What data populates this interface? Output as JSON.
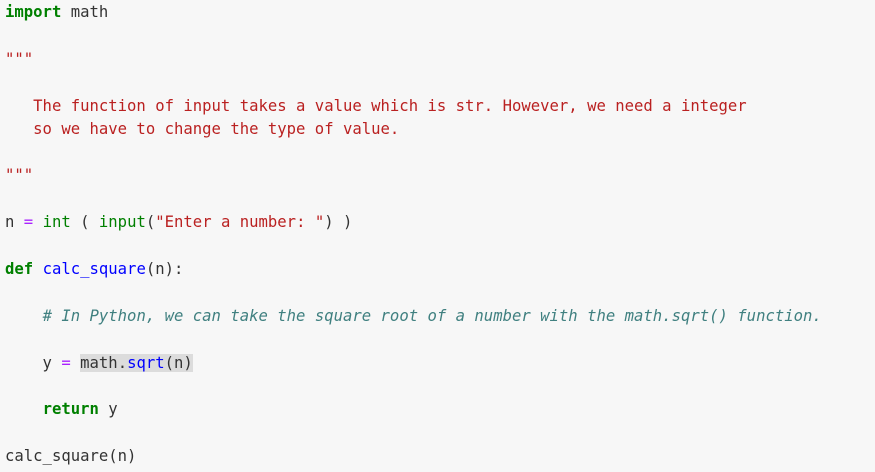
{
  "code": {
    "import_kw": "import",
    "import_mod": " math",
    "docstring_open": "\"\"\"",
    "doc_line1": "   The function of input takes a value which is str. However, we need a integer",
    "doc_line2": "   so we have to change the type of value.",
    "docstring_close": "\"\"\"",
    "assign_var": "n ",
    "assign_op": "=",
    "int_fn": "int",
    "paren_open": " ( ",
    "input_fn": "input",
    "input_paren": "(",
    "input_str": "\"Enter a number: \"",
    "input_tail": ") )",
    "def_kw": "def",
    "def_sp": " ",
    "def_name": "calc_square",
    "def_params": "(n):",
    "comment": "# In Python, we can take the square root of a number with the math.sqrt() function.",
    "y_indent": "    y ",
    "y_op": "=",
    "y_sp": " ",
    "y_math": "math",
    "y_dot": ".",
    "y_sqrt": "sqrt",
    "y_args": "(n)",
    "return_indent": "    ",
    "return_kw": "return",
    "return_val": " y",
    "call": "calc_square(n)"
  }
}
